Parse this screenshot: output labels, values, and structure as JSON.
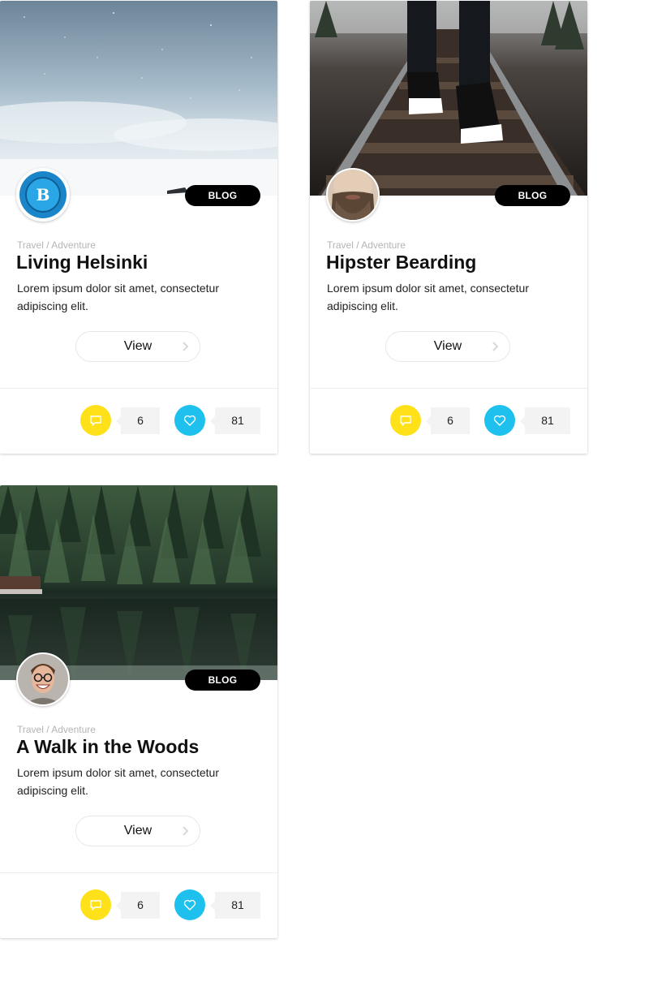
{
  "cards": [
    {
      "category": "Travel / Adventure",
      "title": "Living Helsinki",
      "description": "Lorem ipsum dolor sit amet, consectetur adipiscing elit.",
      "badge": "BLOG",
      "view_label": "View",
      "comments": "6",
      "likes": "81",
      "image": "snowy-sky-photo",
      "avatar": "blue-logo-avatar"
    },
    {
      "category": "Travel / Adventure",
      "title": "Hipster Bearding",
      "description": "Lorem ipsum dolor sit amet, consectetur adipiscing elit.",
      "badge": "BLOG",
      "view_label": "View",
      "comments": "6",
      "likes": "81",
      "image": "railway-sneakers-photo",
      "avatar": "bearded-man-avatar"
    },
    {
      "category": "Travel / Adventure",
      "title": "A Walk in the Woods",
      "description": "Lorem ipsum dolor sit amet, consectetur adipiscing elit.",
      "badge": "BLOG",
      "view_label": "View",
      "comments": "6",
      "likes": "81",
      "image": "forest-lake-photo",
      "avatar": "smiling-man-glasses-avatar"
    }
  ],
  "colors": {
    "comments_accent": "#ffe11a",
    "likes_accent": "#1ec0ee",
    "badge_bg": "#000000"
  },
  "icons": {
    "comments": "speech-bubble-icon",
    "likes": "heart-icon",
    "view": "chevron-right-icon"
  }
}
